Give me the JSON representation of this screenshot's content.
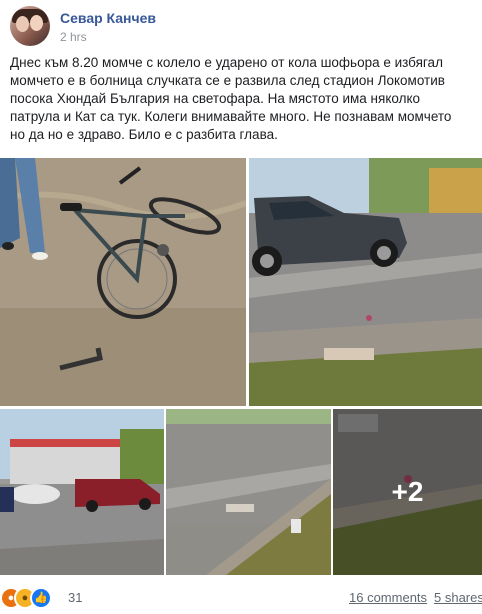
{
  "post": {
    "author": "Севар Канчев",
    "time": "2 hrs",
    "text_lines": [
      "Днес към 8.20 момче с колело е ударено от кола шофьора е избягал",
      "момчето е в болница случката се е развила след стадион Локомотив",
      "посока Хюндай България на светофара. На мястото има няколко",
      "патрула и Кат са тук. Колеги внимавайте много. Не познавам момчето",
      "но да но е здраво. Било е с разбита глава."
    ],
    "more_photos": "+2"
  },
  "footer": {
    "reactions": [
      "angry-icon",
      "sad-icon",
      "like-icon"
    ],
    "reaction_count": "31",
    "comments": "16 comments",
    "shares": "5 shares"
  },
  "colors": {
    "name": "#385898",
    "meta": "#90949c",
    "like": "#1877f2"
  }
}
